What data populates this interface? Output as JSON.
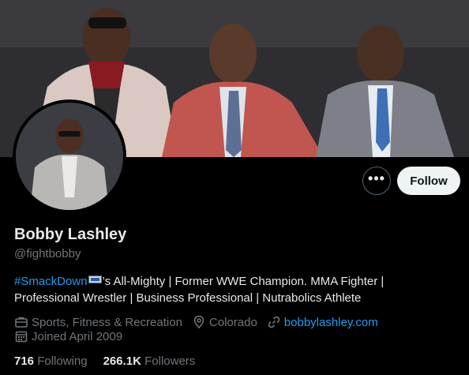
{
  "profile": {
    "display_name": "Bobby Lashley",
    "handle": "@fightbobby",
    "follow_label": "Follow",
    "more_label": "•••"
  },
  "bio": {
    "hashtag": "#SmackDown",
    "text_line1": "’s All-Mighty | Former WWE Champion. MMA Fighter |",
    "text_line2": "Professional Wrestler | Business Professional | Nutrabolics Athlete"
  },
  "meta": {
    "category": "Sports, Fitness & Recreation",
    "location": "Colorado",
    "website": "bobbylashley.com",
    "joined": "Joined April 2009"
  },
  "counts": {
    "following_value": "716",
    "following_label": "Following",
    "followers_value": "266.1K",
    "followers_label": "Followers"
  },
  "colors": {
    "background": "#000000",
    "link": "#1d9bf0",
    "secondary_text": "#71767b",
    "primary_text": "#e7e9ea",
    "follow_button_bg": "#eff3f4"
  },
  "icons": {
    "more": "more-dots-icon",
    "category": "briefcase-icon",
    "location": "location-pin-icon",
    "website": "link-icon",
    "joined": "calendar-icon"
  }
}
